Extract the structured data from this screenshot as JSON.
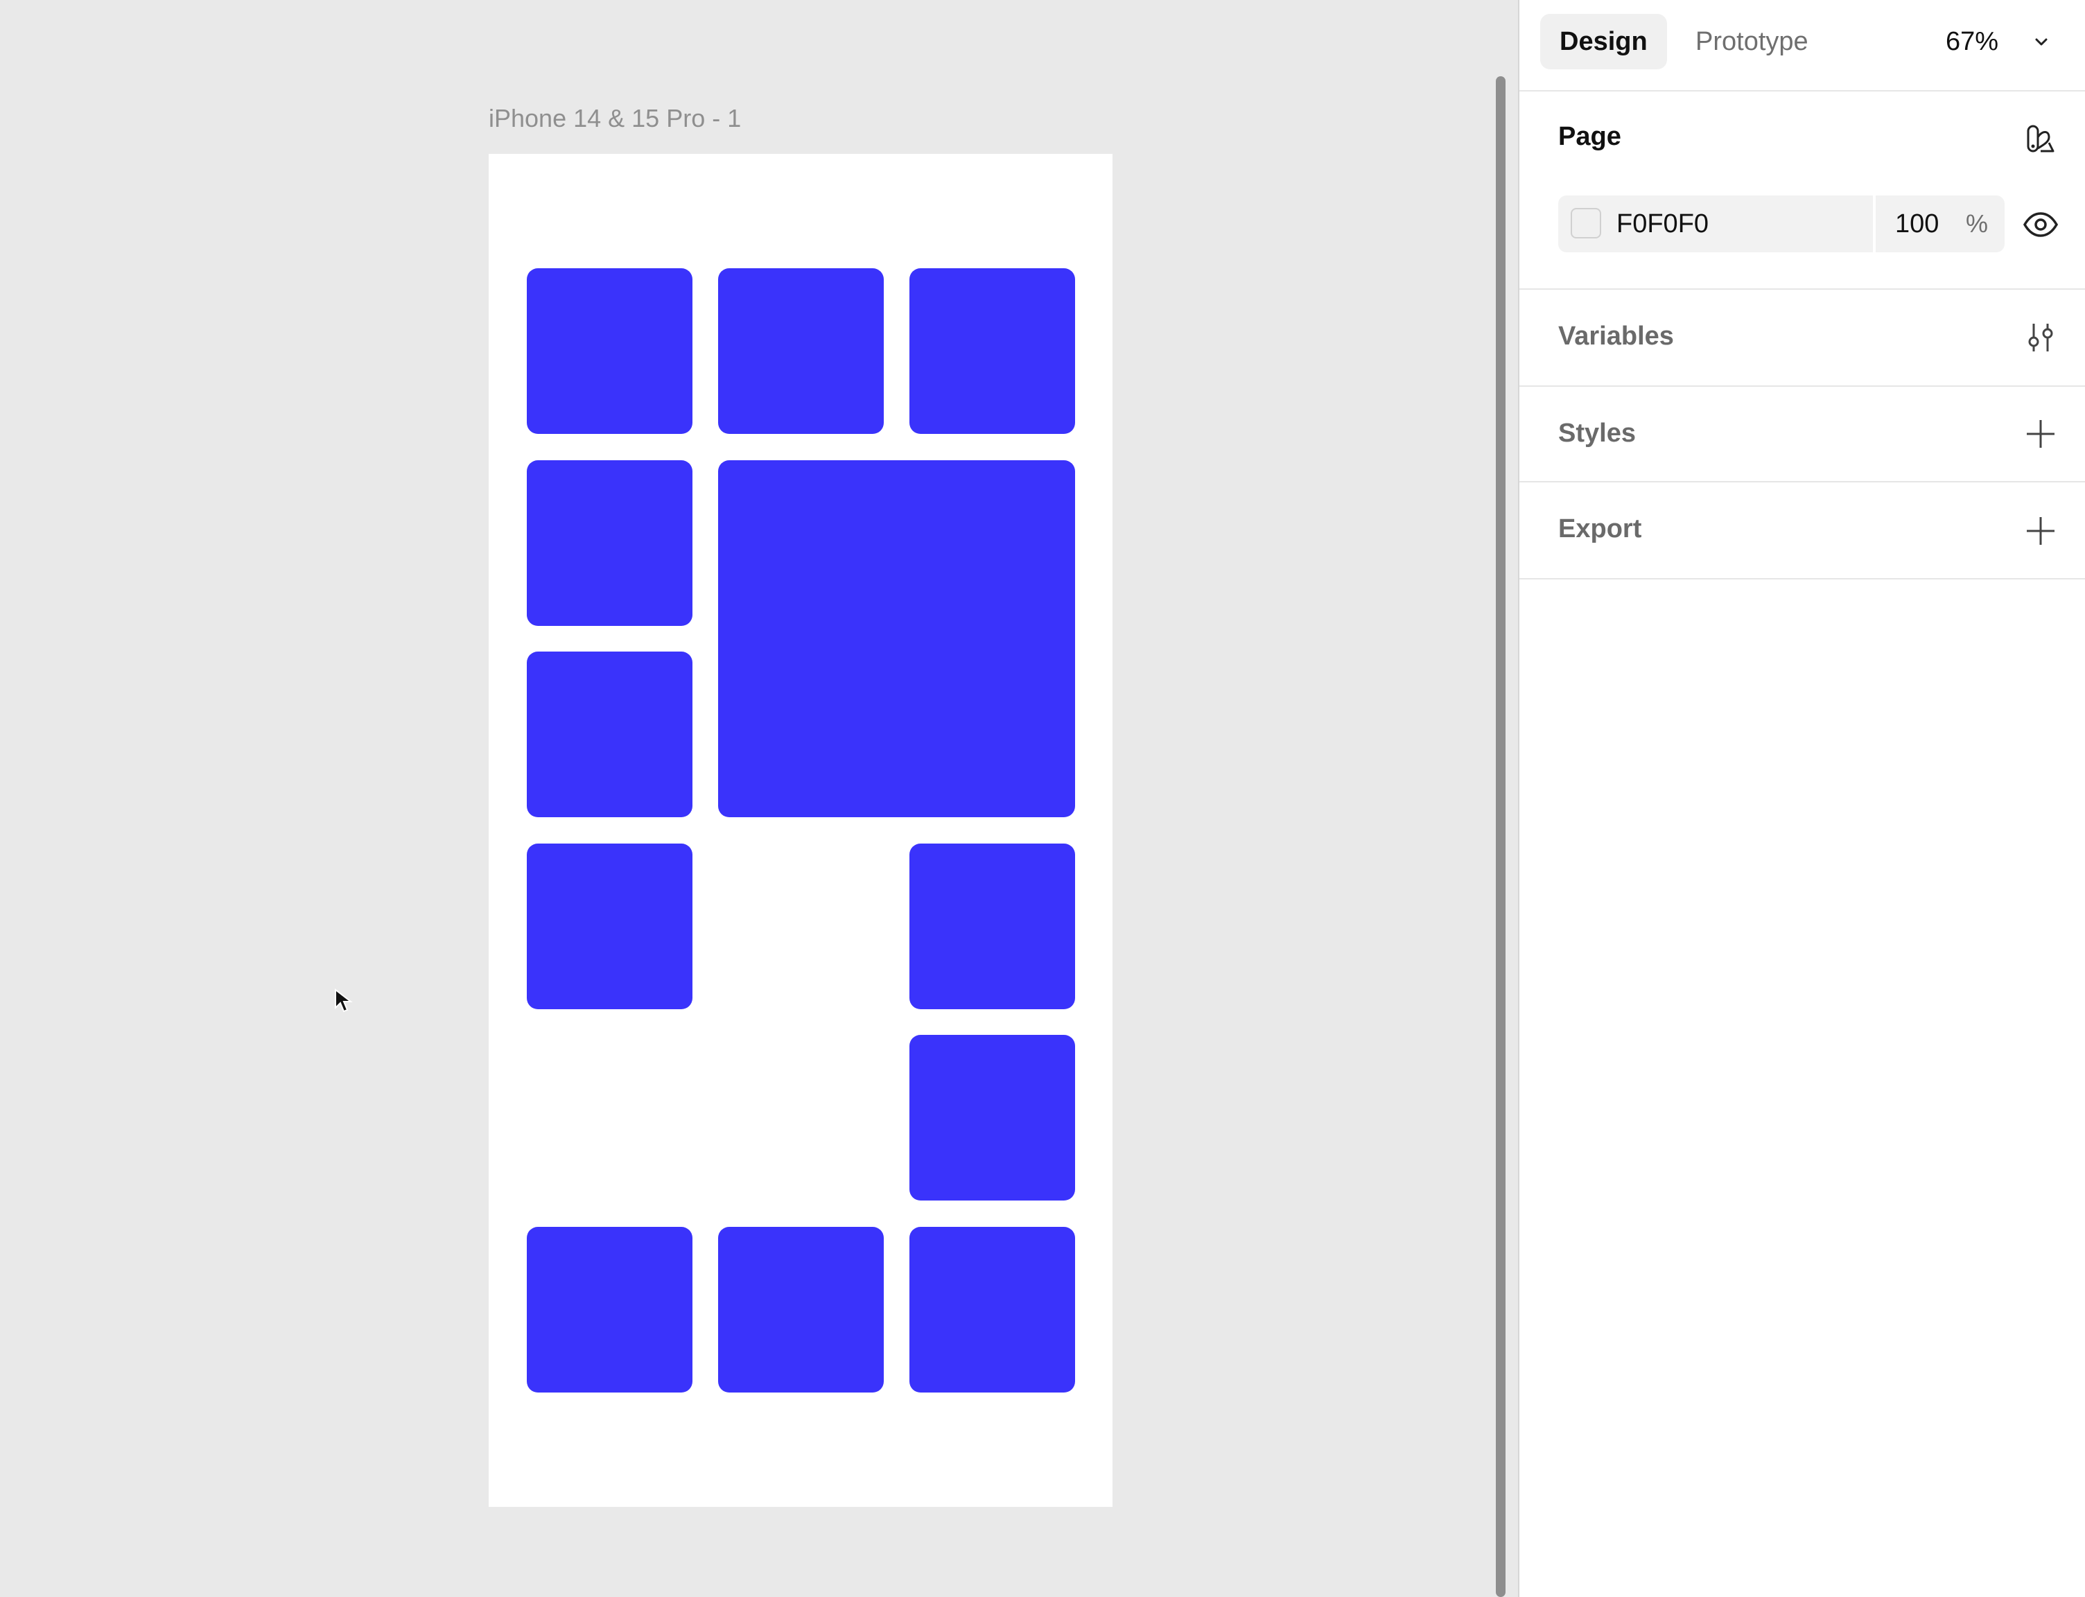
{
  "canvas": {
    "frame_label": "iPhone 14 & 15 Pro - 1",
    "tile_color": "#3a33fb",
    "background_color": "#e9e9e9"
  },
  "panel": {
    "tabs": [
      {
        "label": "Design",
        "active": true
      },
      {
        "label": "Prototype",
        "active": false
      }
    ],
    "zoom": "67%",
    "page_section": {
      "title": "Page",
      "color_hex": "F0F0F0",
      "opacity": "100",
      "opacity_unit": "%"
    },
    "variables_title": "Variables",
    "styles_title": "Styles",
    "export_title": "Export"
  },
  "icons": {
    "page_style": "page-style-icon",
    "visibility": "eye-icon",
    "variables": "sliders-icon",
    "add_style": "plus-icon",
    "add_export": "plus-icon",
    "zoom_dropdown": "chevron-down-icon"
  }
}
